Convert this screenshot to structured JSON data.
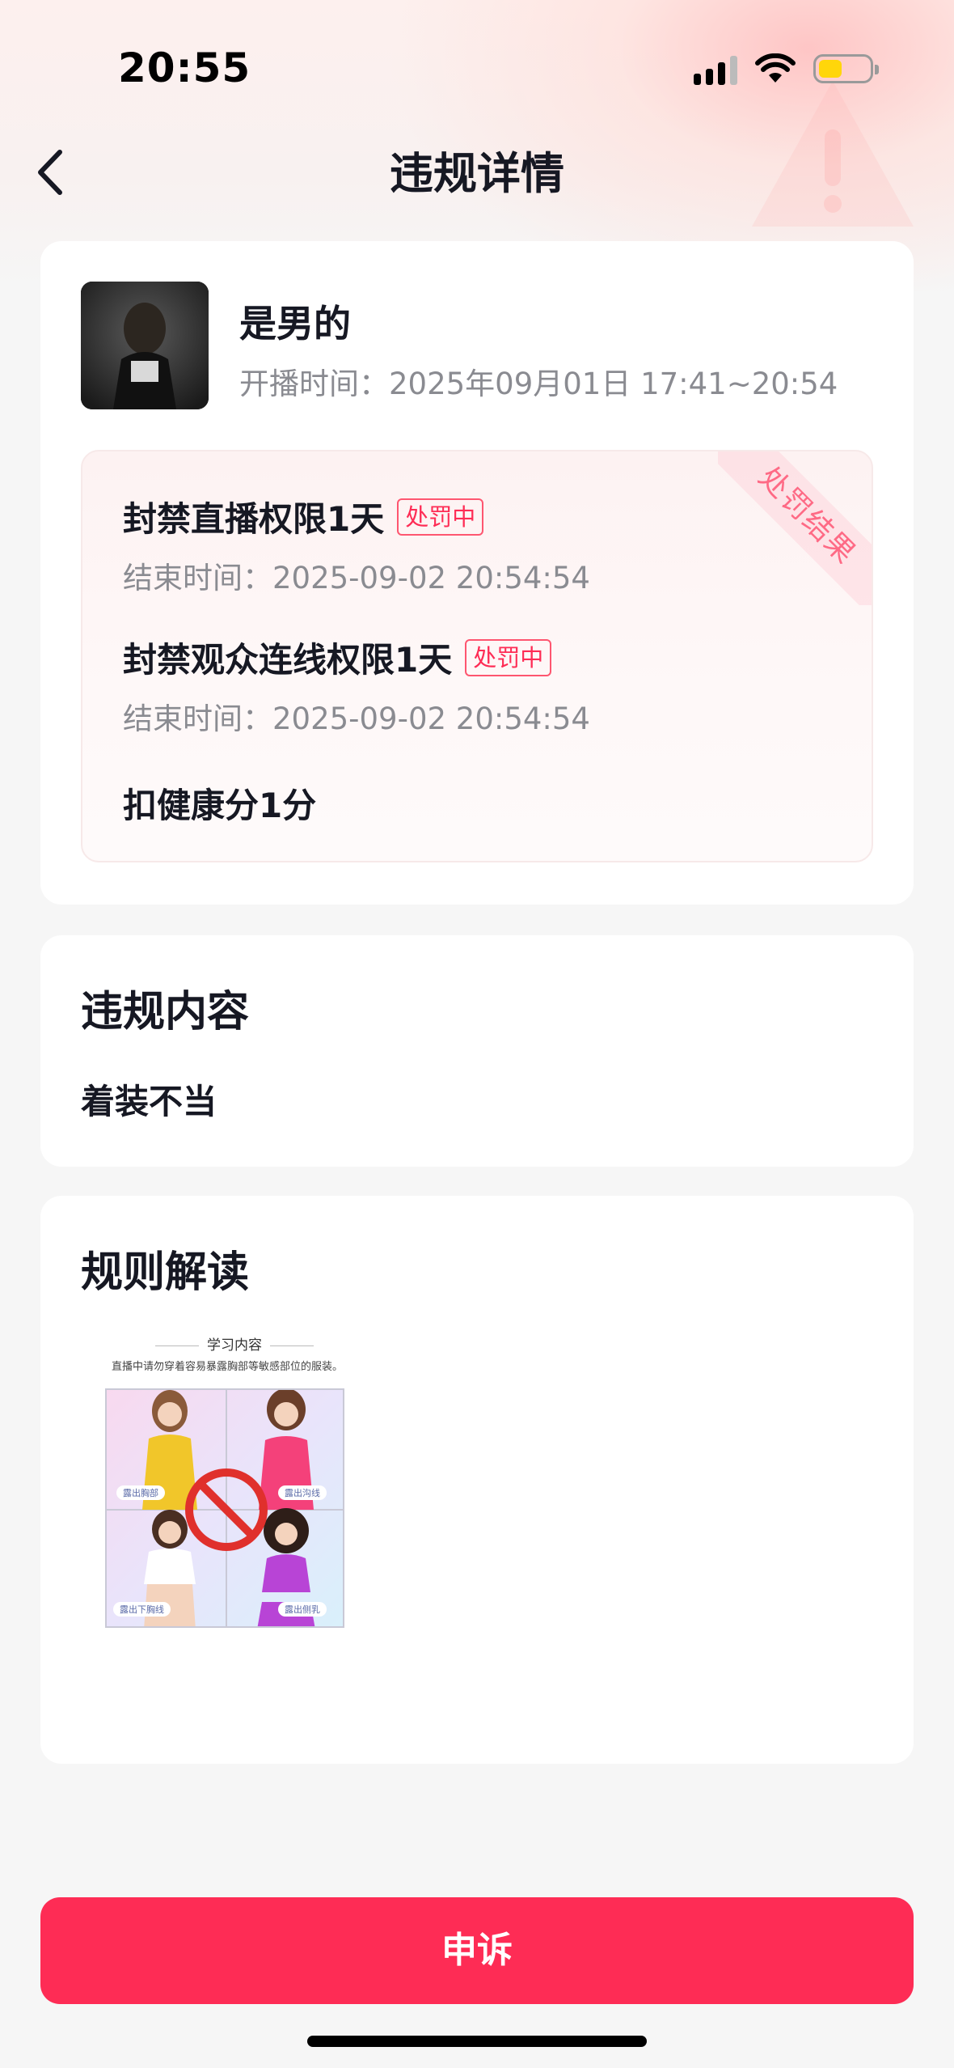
{
  "status_bar": {
    "time": "20:55"
  },
  "nav": {
    "title": "违规详情"
  },
  "stream": {
    "user_name": "是男的",
    "time_label": "开播时间：",
    "time_value": "2025年09月01日 17:41~20:54"
  },
  "penalty": {
    "ribbon": "处罚结果",
    "items": [
      {
        "title": "封禁直播权限1天",
        "tag": "处罚中",
        "end": "结束时间：2025-09-02 20:54:54"
      },
      {
        "title": "封禁观众连线权限1天",
        "tag": "处罚中",
        "end": "结束时间：2025-09-02 20:54:54"
      },
      {
        "title": "扣健康分1分"
      }
    ]
  },
  "violation": {
    "title": "违规内容",
    "content": "着装不当"
  },
  "rules": {
    "title": "规则解读",
    "image_title": "学习内容",
    "image_desc": "直播中请勿穿着容易暴露胸部等敏感部位的服装。",
    "image_labels": [
      "露出胸部",
      "露出沟线",
      "露出下胸线",
      "露出侧乳"
    ]
  },
  "actions": {
    "appeal": "申诉"
  },
  "colors": {
    "accent": "#fe2c55",
    "tag_border": "#fe5670",
    "muted_text": "#8a8b91"
  }
}
